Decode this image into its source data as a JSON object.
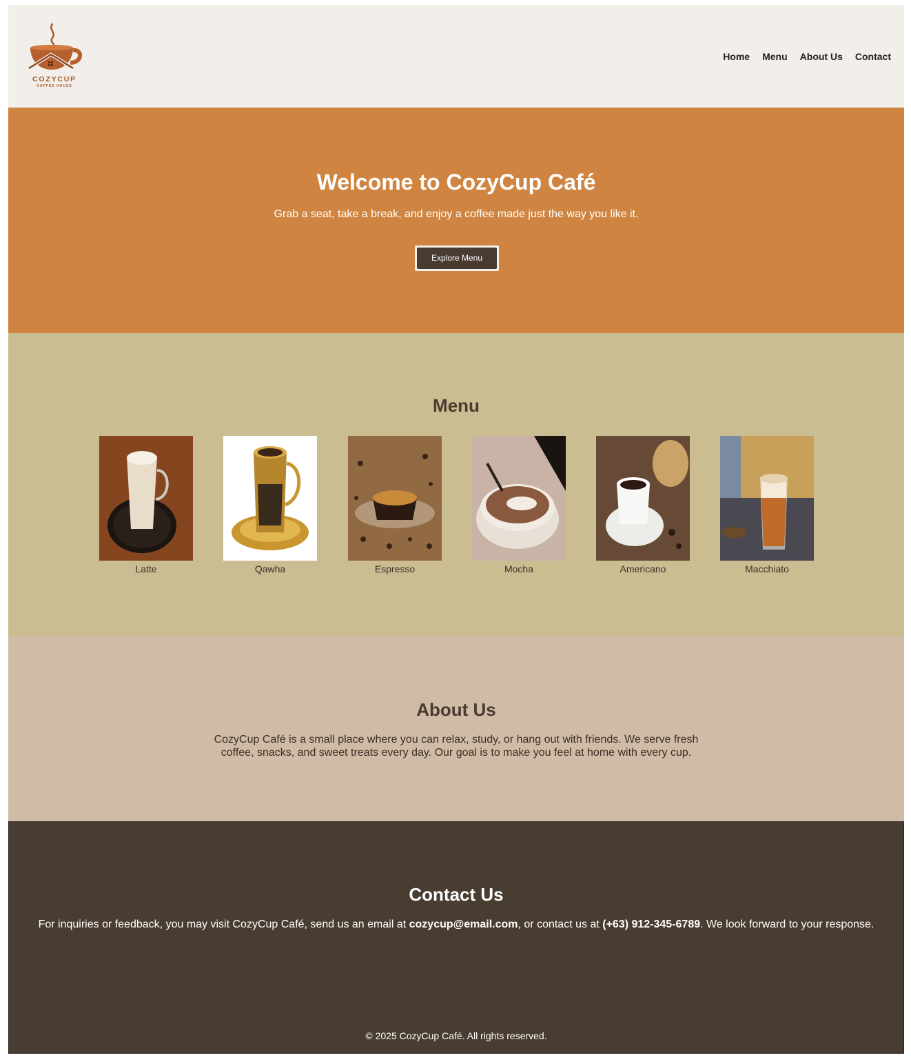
{
  "header": {
    "logo_text": "COZYCUP",
    "logo_subtext": "COFFEE HOUSE",
    "nav": [
      "Home",
      "Menu",
      "About Us",
      "Contact"
    ]
  },
  "hero": {
    "title": "Welcome to CozyCup Café",
    "subtitle": "Grab a seat, take a break, and enjoy a coffee made just the way you like it.",
    "button_label": "Explore Menu"
  },
  "menu": {
    "title": "Menu",
    "items": [
      {
        "label": "Latte",
        "icon": "latte-photo"
      },
      {
        "label": "Qawha",
        "icon": "qawha-photo"
      },
      {
        "label": "Espresso",
        "icon": "espresso-photo"
      },
      {
        "label": "Mocha",
        "icon": "mocha-photo"
      },
      {
        "label": "Americano",
        "icon": "americano-photo"
      },
      {
        "label": "Macchiato",
        "icon": "macchiato-photo"
      }
    ]
  },
  "about": {
    "title": "About Us",
    "text": "CozyCup Café is a small place where you can relax, study, or hang out with friends. We serve fresh coffee, snacks, and sweet treats every day. Our goal is to make you feel at home with every cup."
  },
  "contact": {
    "title": "Contact Us",
    "text_before_email": "For inquiries or feedback, you may visit CozyCup Café, send us an email at ",
    "email": "cozycup@email.com",
    "text_before_phone": ", or contact us at ",
    "phone": "(+63) 912-345-6789",
    "text_after_phone": ". We look forward to your response.",
    "footer": "© 2025 CozyCup Café. All rights reserved."
  },
  "colors": {
    "header_bg": "#f2eeea",
    "hero_bg": "#cf8541",
    "menu_bg": "#cbbd92",
    "about_bg": "#cfbba6",
    "contact_bg": "#493c30",
    "button_bg": "#4a3b31"
  }
}
